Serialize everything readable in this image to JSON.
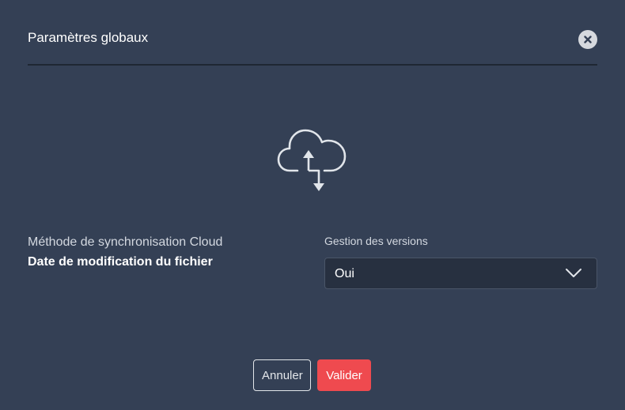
{
  "dialog": {
    "title": "Paramètres globaux",
    "close_icon": "close-icon"
  },
  "cloud_icon": "cloud-sync-icon",
  "sync": {
    "label": "Méthode de synchronisation Cloud",
    "value": "Date de modification du fichier"
  },
  "versions": {
    "label": "Gestion des versions",
    "selected": "Oui",
    "chevron_icon": "chevron-down-icon"
  },
  "actions": {
    "cancel_label": "Annuler",
    "submit_label": "Valider"
  },
  "colors": {
    "background": "#344055",
    "accent": "#ef4a4f",
    "select_background": "#273040"
  }
}
